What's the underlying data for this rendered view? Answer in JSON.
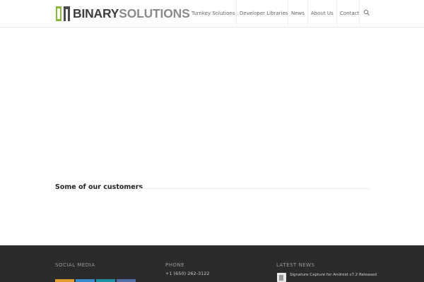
{
  "header": {
    "logo": {
      "part1": "BINARY",
      "part2": "SOLUTIONS",
      "colors": {
        "mark_green": "#8cb83a",
        "mark_dark": "#4a4a4a"
      }
    },
    "nav": [
      {
        "label": "Turnkey Solutions"
      },
      {
        "label": "Developer Libraries"
      },
      {
        "label": "News"
      },
      {
        "label": "About Us"
      },
      {
        "label": "Contact"
      }
    ],
    "search_icon": "search-icon"
  },
  "main": {
    "customers_heading": "Some of our customers"
  },
  "footer": {
    "social": {
      "heading": "SOCIAL MEDIA",
      "buttons": [
        {
          "icon": "facebook-icon",
          "color": "#e0a032"
        },
        {
          "icon": "twitter-icon",
          "color": "#3a8ccf"
        },
        {
          "icon": "linkedin-icon",
          "color": "#1f8fa8"
        },
        {
          "icon": "google-plus-icon",
          "color": "#4f6fa5"
        }
      ]
    },
    "phone": {
      "heading": "PHONE",
      "number": "+1 (650) 262-3122"
    },
    "news": {
      "heading": "LATEST NEWS",
      "items": [
        {
          "title": "Signature Capture for Android v7.2 Released"
        }
      ]
    },
    "colors": {
      "background": "#2b2b2b"
    }
  }
}
